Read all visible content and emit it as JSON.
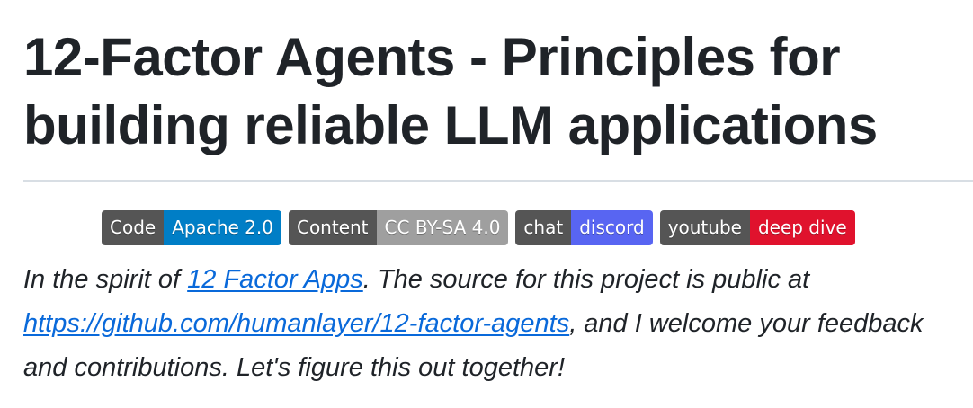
{
  "page": {
    "title": "12-Factor Agents - Principles for building reliable LLM applications"
  },
  "badges": [
    {
      "left": "Code",
      "right": "Apache 2.0",
      "color": "#007ec6"
    },
    {
      "left": "Content",
      "right": "CC BY-SA 4.0",
      "color": "#9f9f9f"
    },
    {
      "left": "chat",
      "right": "discord",
      "color": "#5865f2"
    },
    {
      "left": "youtube",
      "right": "deep dive",
      "color": "#e0122d"
    }
  ],
  "intro": {
    "prefix": "In the spirit of ",
    "link1": "12 Factor Apps",
    "middle": ". The source for this project is public at ",
    "link2": "https://github.com/humanlayer/12-factor-agents",
    "suffix": ", and I welcome your feedback and contributions. Let's figure this out together!"
  },
  "colors": {
    "text": "#1f2328",
    "link": "#0969da",
    "rule": "#d8dee4",
    "badge_label": "#555555"
  }
}
